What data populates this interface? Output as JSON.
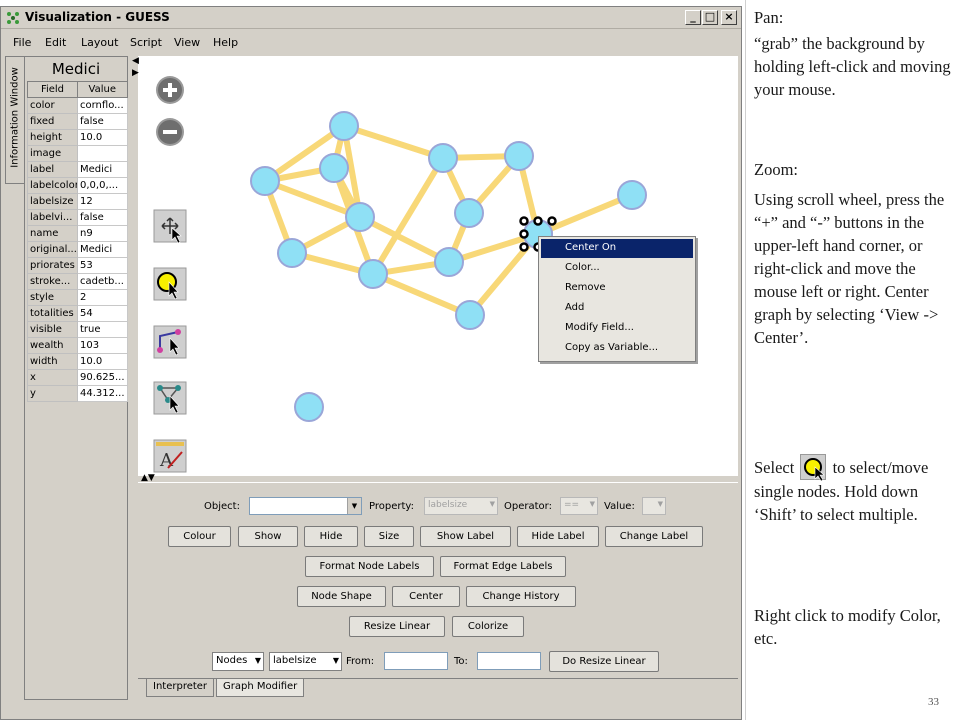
{
  "window": {
    "title": "Visualization - GUESS",
    "controls": {
      "minimize": "_",
      "maximize": "□",
      "close": "×"
    }
  },
  "menubar": [
    "File",
    "Edit",
    "Layout",
    "Script",
    "View",
    "Help"
  ],
  "info_panel": {
    "tab_label": "Information Window",
    "title": "Medici",
    "headers": [
      "Field",
      "Value"
    ],
    "rows": [
      [
        "color",
        "cornflo..."
      ],
      [
        "fixed",
        "false"
      ],
      [
        "height",
        "10.0"
      ],
      [
        "image",
        ""
      ],
      [
        "label",
        "Medici"
      ],
      [
        "labelcolor",
        "0,0,0,..."
      ],
      [
        "labelsize",
        "12"
      ],
      [
        "labelvi...",
        "false"
      ],
      [
        "name",
        "n9"
      ],
      [
        "original...",
        "Medici"
      ],
      [
        "priorates",
        "53"
      ],
      [
        "stroke...",
        "cadetb..."
      ],
      [
        "style",
        "2"
      ],
      [
        "totalities",
        "54"
      ],
      [
        "visible",
        "true"
      ],
      [
        "wealth",
        "103"
      ],
      [
        "width",
        "10.0"
      ],
      [
        "x",
        "90.625..."
      ],
      [
        "y",
        "44.312..."
      ]
    ]
  },
  "tools": [
    "zoom-in-icon",
    "zoom-out-icon",
    "pan-tool-icon",
    "select-tool-icon",
    "edge-tool-icon",
    "node-tool-icon",
    "annotate-tool-icon"
  ],
  "colors": {
    "node_fill": "#8fe0f5",
    "node_stroke": "#9aa6d8",
    "edge": "#f8d878",
    "menu_highlight": "#0a246a"
  },
  "context_menu": {
    "items": [
      "Center On",
      "Color...",
      "Remove",
      "Add",
      "Modify Field...",
      "Copy as Variable..."
    ],
    "selected": 0
  },
  "modifier": {
    "object_label": "Object:",
    "object_value": "",
    "property_label": "Property:",
    "property_value": "labelsize",
    "operator_label": "Operator:",
    "operator_value": "==",
    "value_label": "Value:",
    "value_value": "",
    "row1": [
      "Colour",
      "Show",
      "Hide",
      "Size",
      "Show Label",
      "Hide Label",
      "Change Label"
    ],
    "row2": [
      "Format Node Labels",
      "Format Edge Labels"
    ],
    "row3": [
      "Node Shape",
      "Center",
      "Change History"
    ],
    "row4": [
      "Resize Linear",
      "Colorize"
    ],
    "bottom": {
      "type_value": "Nodes",
      "field_value": "labelsize",
      "from_label": "From:",
      "from_value": "",
      "to_label": "To:",
      "to_value": "",
      "button": "Do Resize Linear"
    }
  },
  "tabs": [
    "Interpreter",
    "Graph Modifier"
  ],
  "notes": {
    "pan_title": "Pan:",
    "pan_text": "“grab” the background by holding left-click and moving your mouse.",
    "zoom_title": "Zoom:",
    "zoom_text": "Using scroll wheel, press the “+” and “-” buttons in the upper-left hand corner, or right-click and move the mouse left or right. Center graph by selecting ‘View -> Center’.",
    "select_before": "Select",
    "select_after": "to select/move single nodes. Hold down ‘Shift’ to select multiple.",
    "right_click": "Right click to modify Color, etc."
  },
  "page_number": "33"
}
